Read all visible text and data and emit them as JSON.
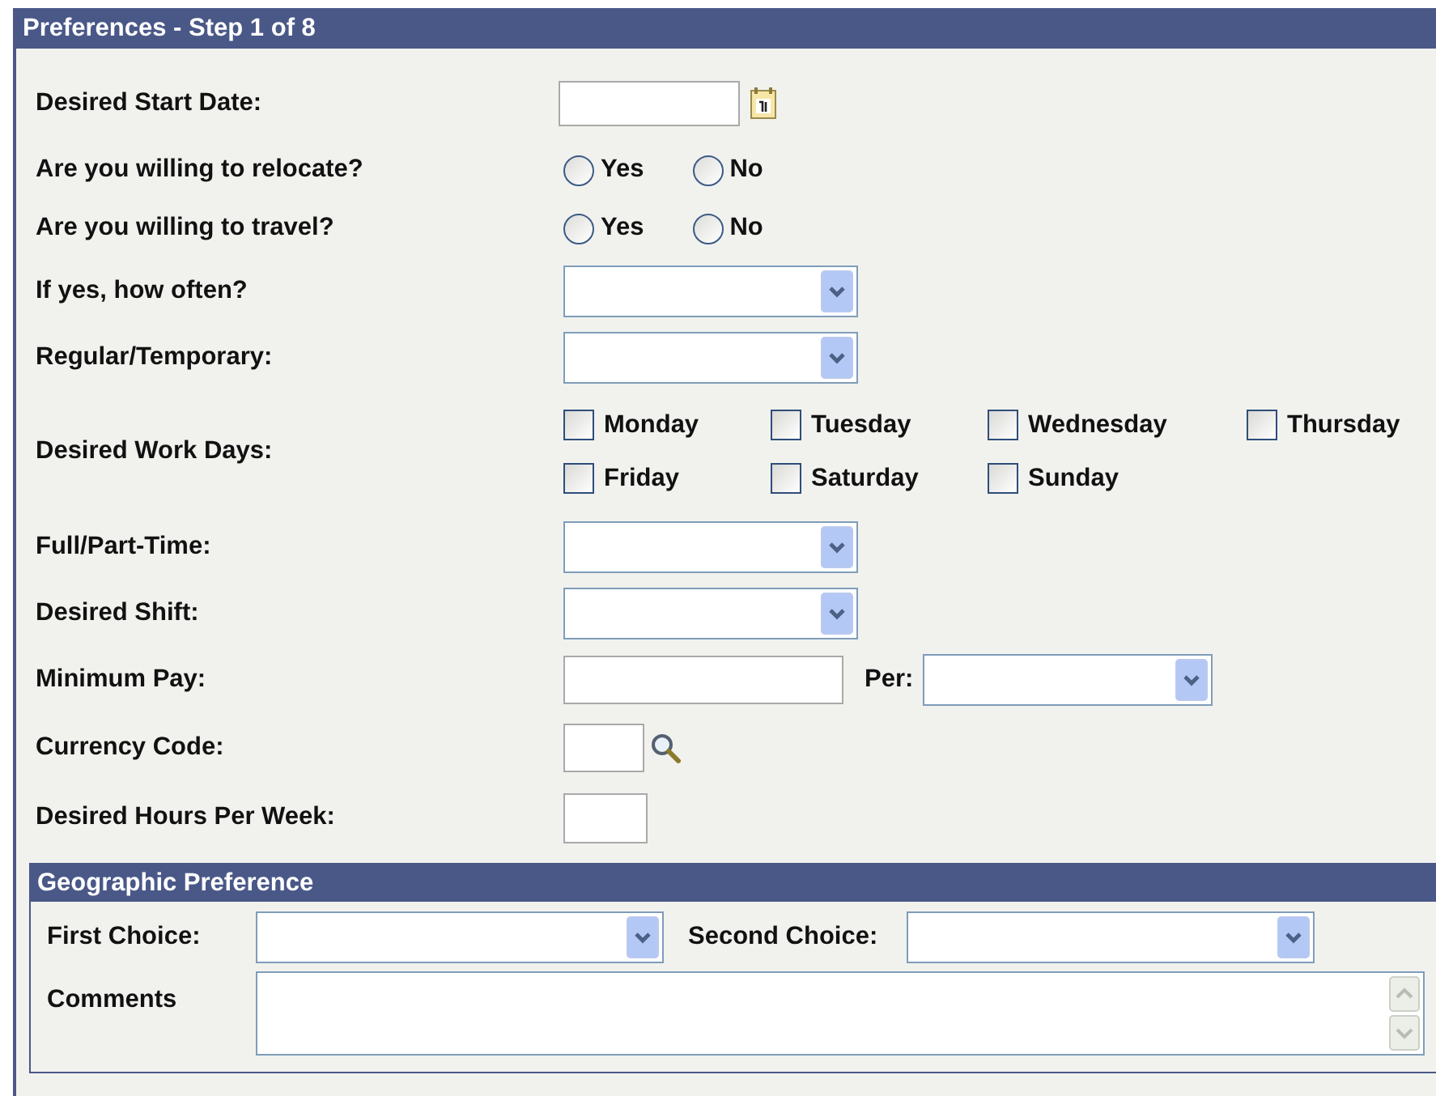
{
  "panel": {
    "title": "Preferences - Step 1 of 8"
  },
  "fields": [
    {
      "kind": "date",
      "label": "Desired Start Date:"
    },
    {
      "kind": "radio",
      "label": "Are you willing to relocate?",
      "options": [
        {
          "label": "Yes",
          "selected": false
        },
        {
          "label": "No",
          "selected": false
        }
      ]
    },
    {
      "kind": "radio",
      "label": "Are you willing to travel?",
      "options": [
        {
          "label": "Yes",
          "selected": false
        },
        {
          "label": "No",
          "selected": false
        }
      ]
    },
    {
      "kind": "select",
      "label": "If yes, how often?"
    },
    {
      "kind": "select",
      "label": "Regular/Temporary:"
    },
    {
      "kind": "checks",
      "label": "Desired Work Days:",
      "options": [
        {
          "label": "Monday",
          "checked": false
        },
        {
          "label": "Tuesday",
          "checked": false
        },
        {
          "label": "Wednesday",
          "checked": false
        },
        {
          "label": "Thursday",
          "checked": false
        },
        {
          "label": "Friday",
          "checked": false
        },
        {
          "label": "Saturday",
          "checked": false
        },
        {
          "label": "Sunday",
          "checked": false
        }
      ]
    },
    {
      "kind": "select",
      "label": "Full/Part-Time:"
    },
    {
      "kind": "select",
      "label": "Desired Shift:"
    },
    {
      "kind": "pay",
      "label": "Minimum Pay:",
      "per_label": "Per:"
    },
    {
      "kind": "lookup",
      "label": "Currency Code:"
    },
    {
      "kind": "short",
      "label": "Desired Hours Per Week:"
    }
  ],
  "geographic": {
    "title": "Geographic Preference",
    "first_label": "First Choice:",
    "second_label": "Second Choice:",
    "comments_label": "Comments"
  }
}
